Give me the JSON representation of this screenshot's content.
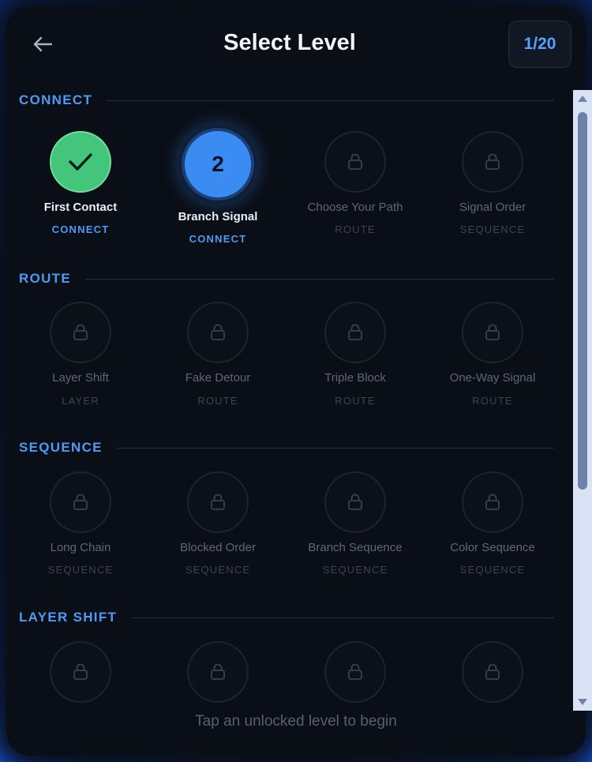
{
  "header": {
    "title": "Select Level",
    "counter": "1/20",
    "back_icon": "arrow-left-icon"
  },
  "colors": {
    "accent": "#4e9bf3",
    "completed": "#43c57c",
    "current": "#3b8cf2",
    "locked_text": "#5f6776"
  },
  "sections": [
    {
      "title": "CONNECT",
      "levels": [
        {
          "name": "First Contact",
          "category": "CONNECT",
          "state": "completed",
          "icon": "check-icon"
        },
        {
          "name": "Branch Signal",
          "category": "CONNECT",
          "state": "current",
          "number": "2"
        },
        {
          "name": "Choose Your Path",
          "category": "ROUTE",
          "state": "locked",
          "icon": "lock-icon"
        },
        {
          "name": "Signal Order",
          "category": "SEQUENCE",
          "state": "locked",
          "icon": "lock-icon"
        }
      ]
    },
    {
      "title": "ROUTE",
      "levels": [
        {
          "name": "Layer Shift",
          "category": "LAYER",
          "state": "locked",
          "icon": "lock-icon"
        },
        {
          "name": "Fake Detour",
          "category": "ROUTE",
          "state": "locked",
          "icon": "lock-icon"
        },
        {
          "name": "Triple Block",
          "category": "ROUTE",
          "state": "locked",
          "icon": "lock-icon"
        },
        {
          "name": "One-Way Signal",
          "category": "ROUTE",
          "state": "locked",
          "icon": "lock-icon"
        }
      ]
    },
    {
      "title": "SEQUENCE",
      "levels": [
        {
          "name": "Long Chain",
          "category": "SEQUENCE",
          "state": "locked",
          "icon": "lock-icon"
        },
        {
          "name": "Blocked Order",
          "category": "SEQUENCE",
          "state": "locked",
          "icon": "lock-icon"
        },
        {
          "name": "Branch Sequence",
          "category": "SEQUENCE",
          "state": "locked",
          "icon": "lock-icon"
        },
        {
          "name": "Color Sequence",
          "category": "SEQUENCE",
          "state": "locked",
          "icon": "lock-icon"
        }
      ]
    },
    {
      "title": "LAYER SHIFT",
      "levels": [
        {
          "name": "",
          "category": "",
          "state": "locked",
          "icon": "lock-icon"
        },
        {
          "name": "",
          "category": "",
          "state": "locked",
          "icon": "lock-icon"
        },
        {
          "name": "",
          "category": "",
          "state": "locked",
          "icon": "lock-icon"
        },
        {
          "name": "",
          "category": "",
          "state": "locked",
          "icon": "lock-icon"
        }
      ]
    }
  ],
  "footer": {
    "hint": "Tap an unlocked level to begin"
  }
}
